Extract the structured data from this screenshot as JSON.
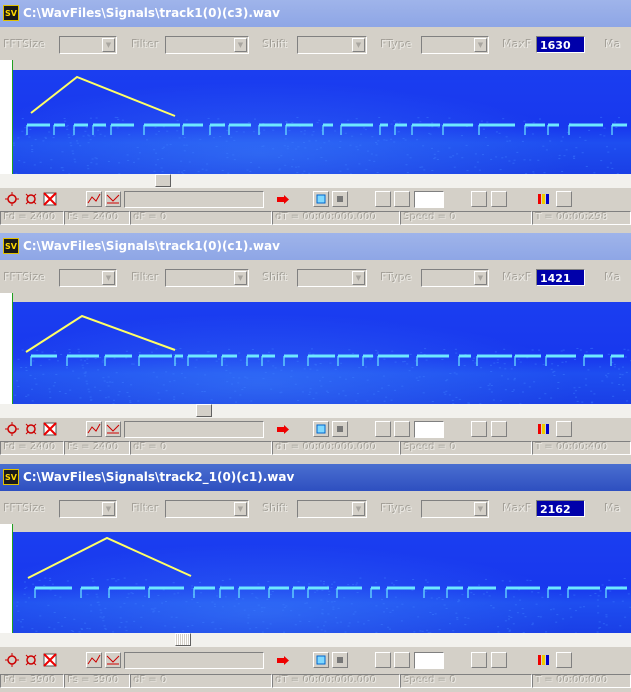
{
  "labels": {
    "fft_size": "FFTSize",
    "filter": "Filter",
    "shift": "Shift",
    "ftype": "FType",
    "maxf": "MaxF",
    "maxf_short": "Ma"
  },
  "windows": [
    {
      "title": "C:\\WavFiles\\Signals\\track1(0)(c3).wav",
      "active": false,
      "maxf": "1630",
      "status": [
        "Fd = 2400",
        "Fs = 2400",
        "dF = 0",
        "dT = 00:00:000.000",
        "Speed = 0",
        "T = 00:00:298"
      ]
    },
    {
      "title": "C:\\WavFiles\\Signals\\track1(0)(c1).wav",
      "active": false,
      "maxf": "1421",
      "status": [
        "Fd = 2400",
        "Fs = 2400",
        "dF = 0",
        "dT = 00:00:000.000",
        "Speed = 0",
        "T = 00:00:400"
      ]
    },
    {
      "title": "C:\\WavFiles\\Signals\\track2_1(0)(c1).wav",
      "active": true,
      "maxf": "2162",
      "status": [
        "Fd = 3900",
        "Fs = 3900",
        "dF = 0",
        "dT = 00:00:000.000",
        "Speed = 0",
        "T = 00:00:000"
      ]
    }
  ],
  "icons": [
    "app-icon",
    "zoom-in-icon",
    "zoom-out-icon",
    "clear-icon",
    "envelope-icon",
    "envelope-alt-icon",
    "record-icon",
    "select-icon",
    "stop-icon",
    "color-scale-icon"
  ],
  "colors": {
    "title_active": "#2e4fc0",
    "title_inactive": "#8ea6e6",
    "spectrogram_bg": "#1838ee",
    "signal_trace": "#6ee8ff",
    "marker_line": "#ffff66",
    "maxf_box": "#0000aa"
  }
}
